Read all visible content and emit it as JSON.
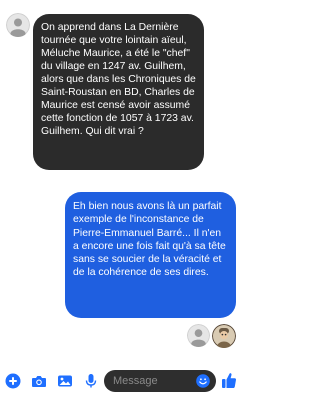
{
  "conversation": {
    "incoming_message": "On apprend dans La Dernière tournée que votre lointain aïeul, Méluche Maurice, a été le \"chef\" du village en 1247 av. Guilhem, alors que dans les Chroniques de Saint-Roustan en BD, Charles de Maurice est censé avoir assumé cette fonction de 1057 à 1723 av. Guilhem. Qui dit vrai ?",
    "outgoing_message": "Eh bien nous avons là un parfait exemple de l'inconstance de Pierre-Emmanuel Barré... Il n'en a encore une fois fait qu'à sa tête sans se soucier de la véracité et de la cohérence de ses dires."
  },
  "composer": {
    "placeholder": "Message",
    "icons": [
      "plus-icon",
      "camera-icon",
      "image-icon",
      "microphone-icon",
      "emoji-icon",
      "thumbs-up-icon"
    ]
  },
  "colors": {
    "incoming_bubble": "#2b2b2b",
    "outgoing_bubble": "#1f5fe0",
    "accent": "#1f6fff",
    "composer_field": "#2e2e2e"
  }
}
